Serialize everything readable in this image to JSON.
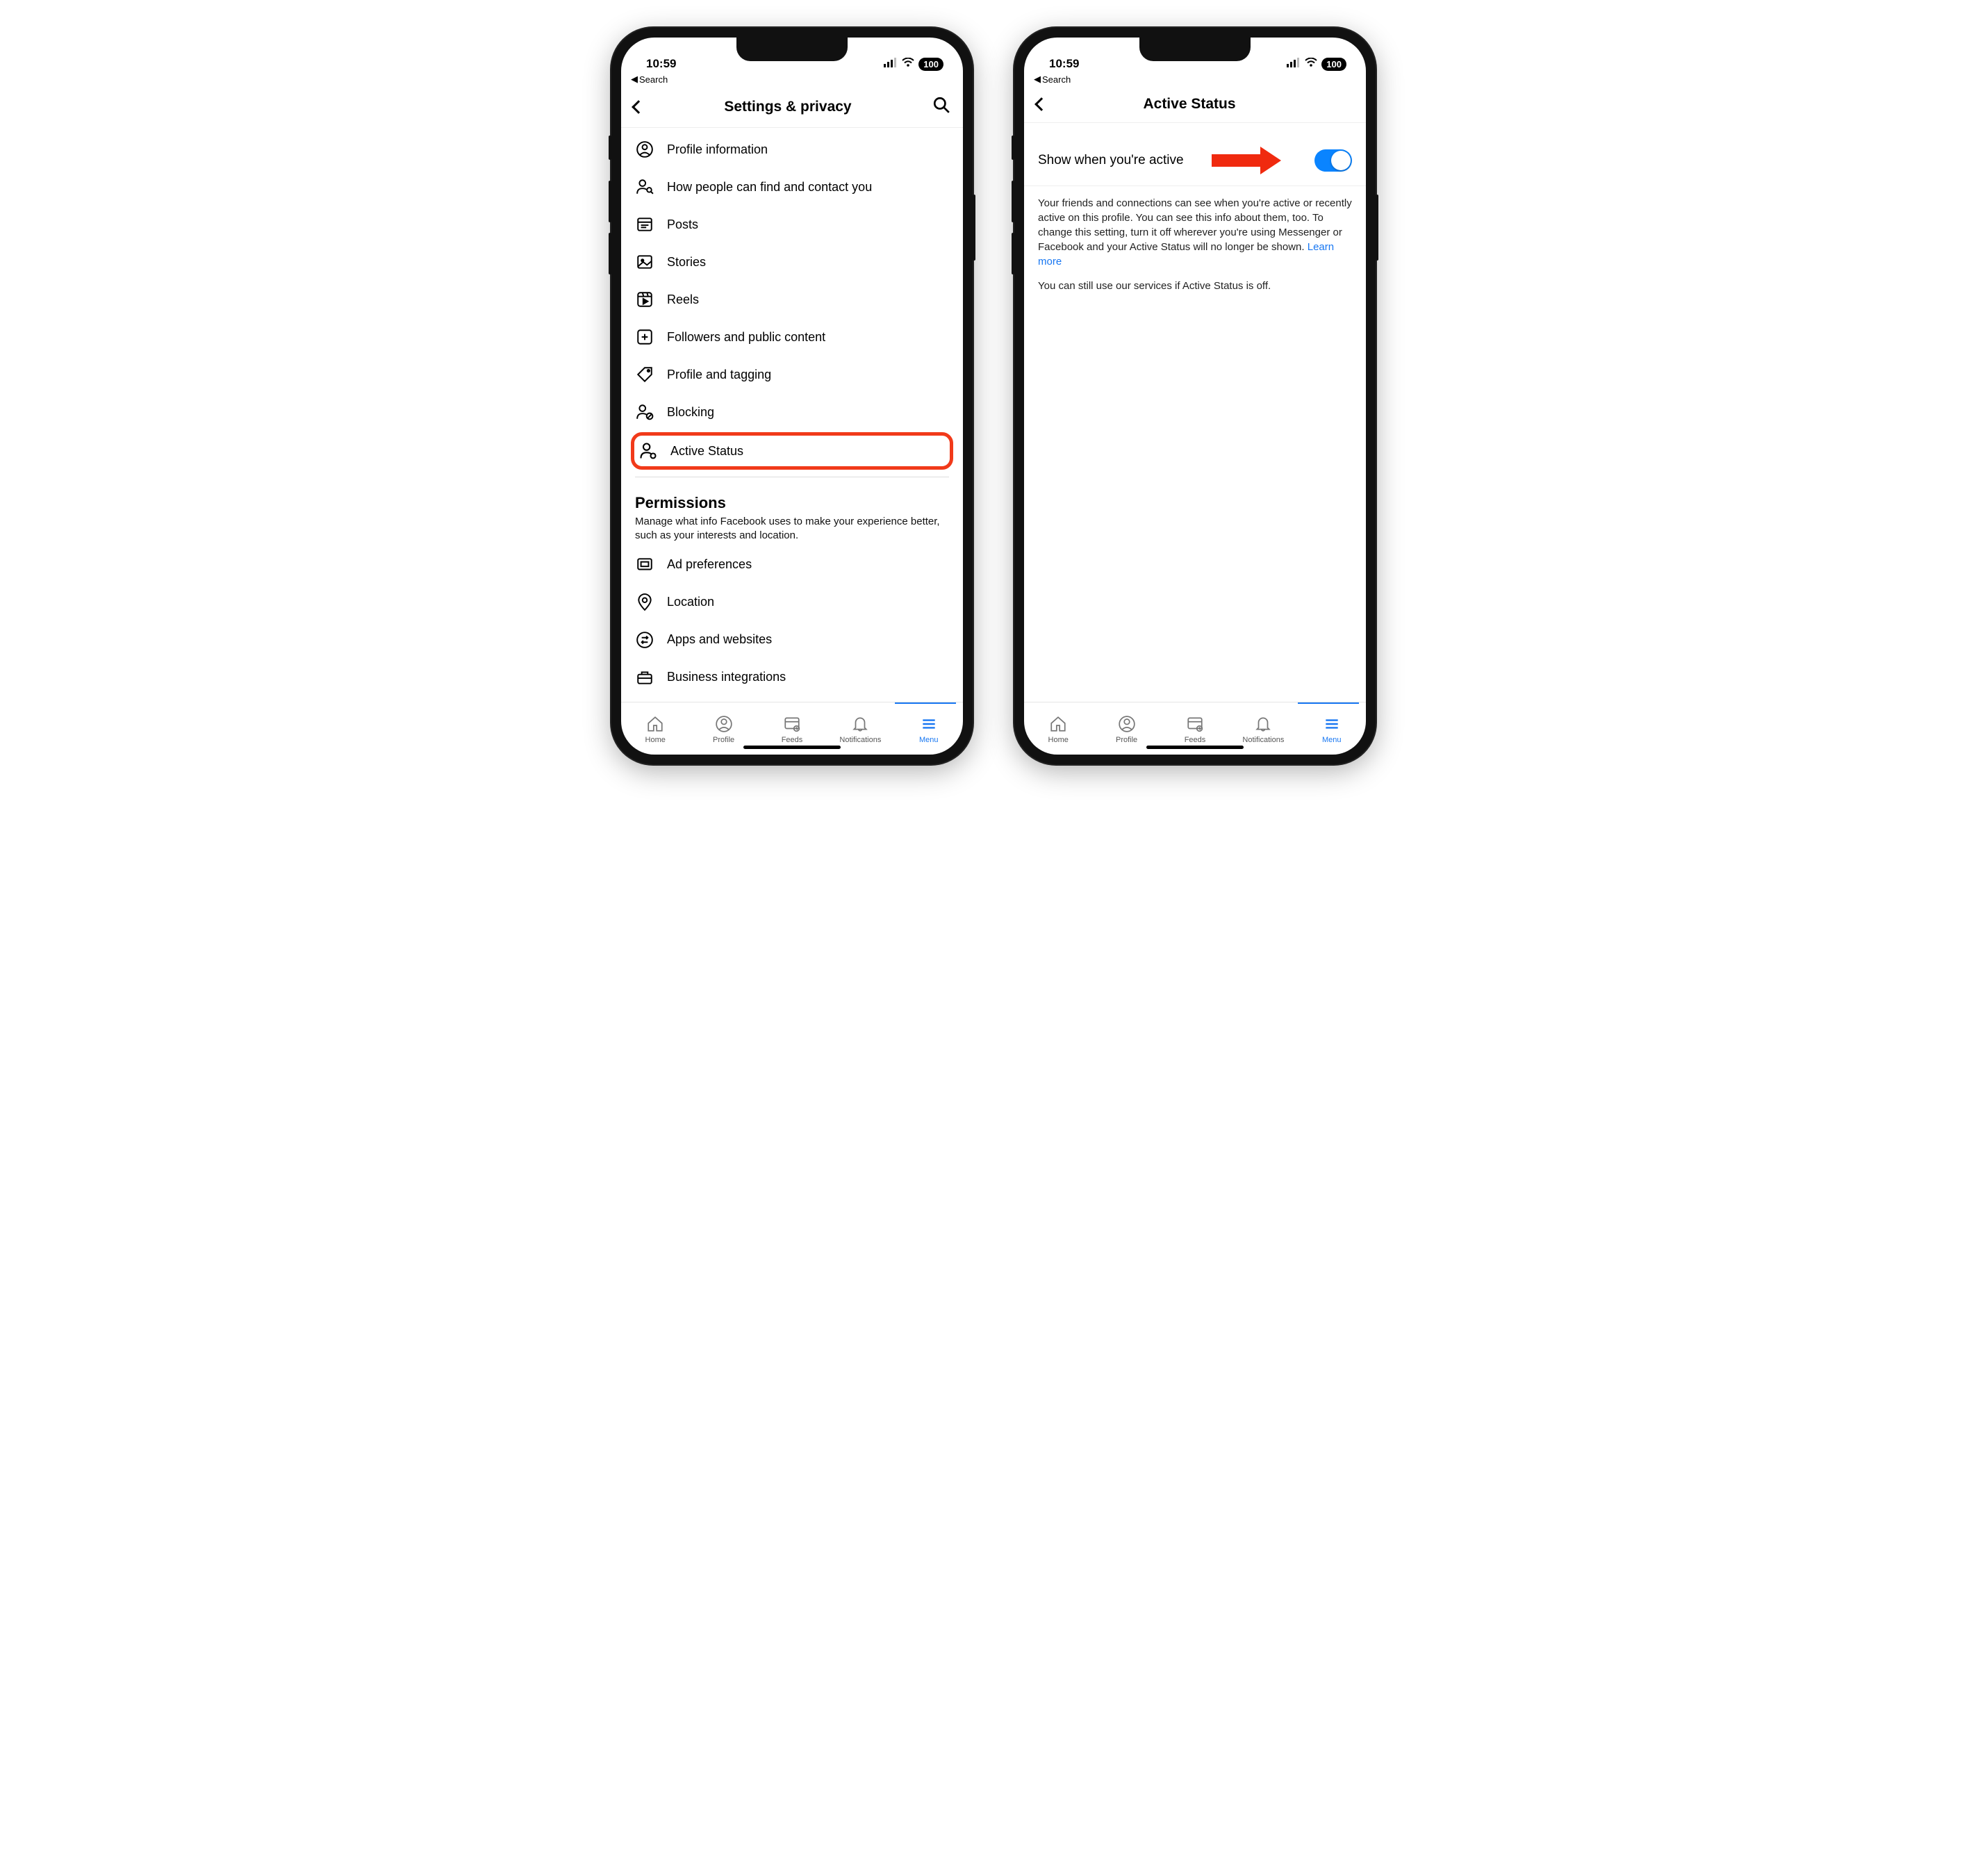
{
  "statusBar": {
    "time": "10:59",
    "batteryLabel": "100",
    "backSearchLabel": "Search"
  },
  "left": {
    "headerTitle": "Settings & privacy",
    "menu": {
      "item0": "Profile information",
      "item1": "How people can find and contact you",
      "item2": "Posts",
      "item3": "Stories",
      "item4": "Reels",
      "item5": "Followers and public content",
      "item6": "Profile and tagging",
      "item7": "Blocking",
      "item8": "Active Status"
    },
    "permissions": {
      "title": "Permissions",
      "desc": "Manage what info Facebook uses to make your experience better, such as your interests and location.",
      "item0": "Ad preferences",
      "item1": "Location",
      "item2": "Apps and websites",
      "item3": "Business integrations"
    }
  },
  "right": {
    "headerTitle": "Active Status",
    "toggleLabel": "Show when you're active",
    "desc1a": "Your friends and connections can see when you're active or recently active on this profile. You can see this info about them, too. To change this setting, turn it off wherever you're using Messenger or Facebook and your Active Status will no longer be shown. ",
    "learnMore": "Learn more",
    "desc2": "You can still use our services if Active Status is off."
  },
  "tabbar": {
    "home": "Home",
    "profile": "Profile",
    "feeds": "Feeds",
    "notifications": "Notifications",
    "menu": "Menu"
  }
}
